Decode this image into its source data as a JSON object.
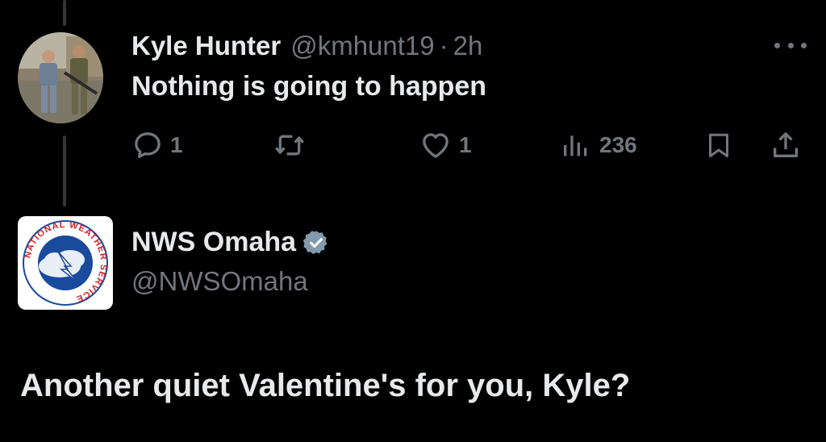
{
  "reply": {
    "author_name": "Kyle Hunter",
    "author_handle": "@kmhunt19",
    "separator": "·",
    "time": "2h",
    "text": "Nothing is going to happen",
    "avatar_icon": "profile-photo",
    "stats": {
      "replies": "1",
      "retweets": "",
      "likes": "1",
      "views": "236"
    }
  },
  "main": {
    "author_name": "NWS Omaha",
    "author_handle": "@NWSOmaha",
    "verified": true,
    "avatar_icon": "nws-logo",
    "logo_text": "NATIONAL WEATHER SERVICE",
    "text": "Another quiet Valentine's for you, Kyle?"
  },
  "colors": {
    "background": "#000000",
    "primary_text": "#e7e9ea",
    "secondary_text": "#71767b",
    "verified_badge": "#829aab",
    "nws_red": "#d42027",
    "nws_blue": "#1a4a9c"
  }
}
